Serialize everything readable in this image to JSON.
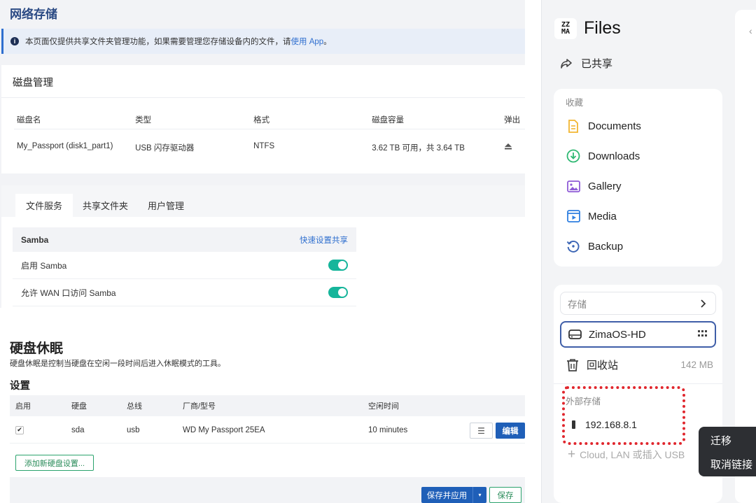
{
  "network_storage": {
    "title": "网络存储",
    "notice_text": "本页面仅提供共享文件夹管理功能，如果需要管理您存储设备内的文件，请",
    "notice_link": "使用 App",
    "notice_end": "。",
    "disk_mgmt": {
      "title": "磁盘管理",
      "columns": [
        "磁盘名",
        "类型",
        "格式",
        "磁盘容量",
        "弹出"
      ],
      "rows": [
        {
          "name": "My_Passport (disk1_part1)",
          "type": "USB 闪存驱动器",
          "format": "NTFS",
          "capacity": "3.62 TB 可用，共 3.64 TB",
          "eject_icon": "eject-icon"
        }
      ]
    },
    "tabs": [
      "文件服务",
      "共享文件夹",
      "用户管理"
    ],
    "samba": {
      "title": "Samba",
      "quick_link": "快速设置共享",
      "rows": [
        {
          "label": "启用 Samba",
          "on": true
        },
        {
          "label": "允许 WAN 口访问 Samba",
          "on": true
        }
      ]
    }
  },
  "disk_sleep": {
    "title": "硬盘休眠",
    "desc": "硬盘休眠是控制当硬盘在空闲一段时间后进入休眠模式的工具。",
    "settings_title": "设置",
    "columns": [
      "启用",
      "硬盘",
      "总线",
      "厂商/型号",
      "空闲时间"
    ],
    "rows": [
      {
        "enabled": "✔",
        "disk": "sda",
        "bus": "usb",
        "model": "WD My Passport 25EA",
        "idle": "10 minutes"
      }
    ],
    "menu_icon": "☰",
    "edit_label": "编辑",
    "add_label": "添加新硬盘设置...",
    "apply_label": "保存并应用",
    "apply_caret": "▾",
    "save_label": "保存"
  },
  "files_app": {
    "logo_text_top": "ZZ",
    "logo_text_bottom": "MA",
    "title": "Files",
    "shared_label": "已共享",
    "favorites_label": "收藏",
    "favorites": [
      {
        "label": "Documents",
        "icon": "document-icon",
        "color": "#f2b632"
      },
      {
        "label": "Downloads",
        "icon": "download-icon",
        "color": "#2eb872"
      },
      {
        "label": "Gallery",
        "icon": "gallery-icon",
        "color": "#8e5bd6"
      },
      {
        "label": "Media",
        "icon": "media-icon",
        "color": "#2f7fe0"
      },
      {
        "label": "Backup",
        "icon": "backup-icon",
        "color": "#3a64b4"
      }
    ],
    "storage_label": "存储",
    "disk_name": "ZimaOS-HD",
    "trash_label": "回收站",
    "trash_size": "142 MB",
    "external_label": "外部存储",
    "external_item": "192.168.8.1",
    "add_external": "Cloud, LAN 或插入 USB",
    "context_menu": [
      "迁移",
      "取消链接"
    ],
    "highlight_color": "#e0262d",
    "selected_border": "#3f5ea8"
  }
}
